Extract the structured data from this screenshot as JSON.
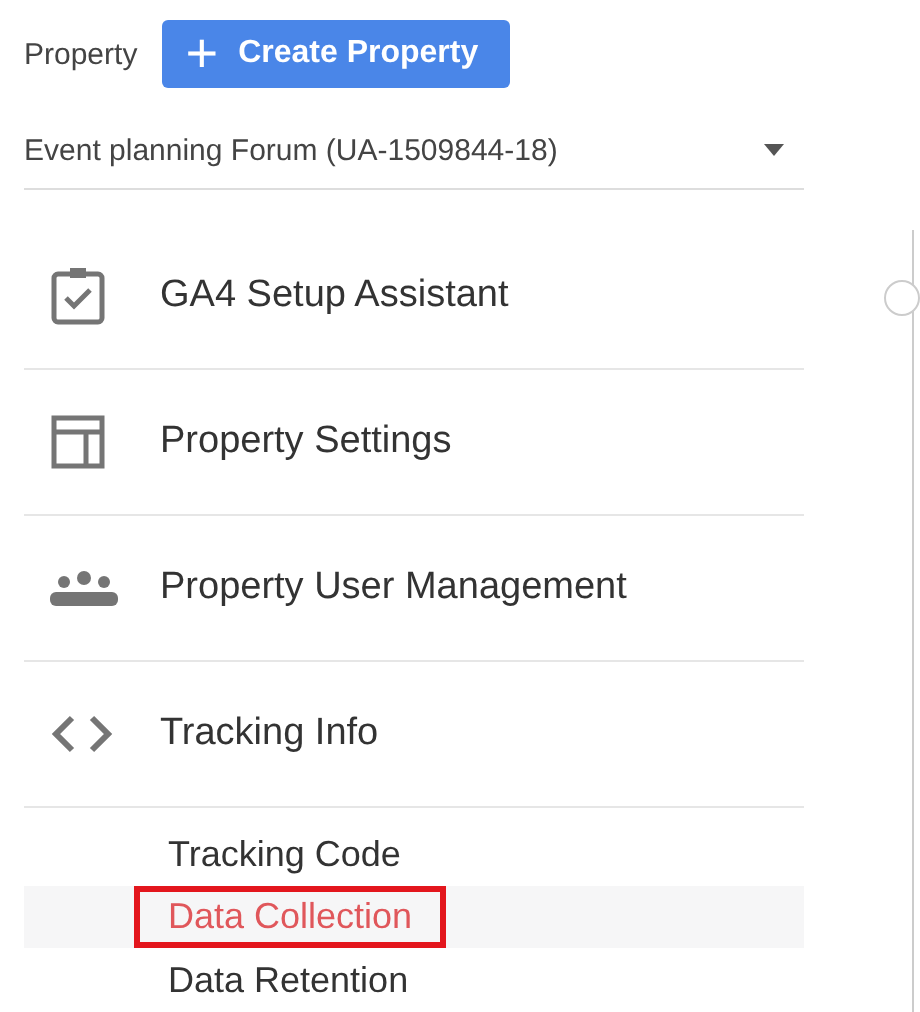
{
  "header": {
    "label": "Property",
    "create_button": {
      "icon": "+",
      "label": "Create Property"
    }
  },
  "property_select": {
    "value": "Event planning Forum (UA-1509844-18)"
  },
  "nav": [
    {
      "kind": "checklist",
      "label": "GA4 Setup Assistant"
    },
    {
      "kind": "layout",
      "label": "Property Settings"
    },
    {
      "kind": "people",
      "label": "Property User Management"
    },
    {
      "kind": "code",
      "label": "Tracking Info",
      "children": [
        {
          "label": "Tracking Code",
          "selected": false,
          "highlighted": false
        },
        {
          "label": "Data Collection",
          "selected": true,
          "highlighted": true
        },
        {
          "label": "Data Retention",
          "selected": false,
          "highlighted": false
        }
      ]
    }
  ]
}
